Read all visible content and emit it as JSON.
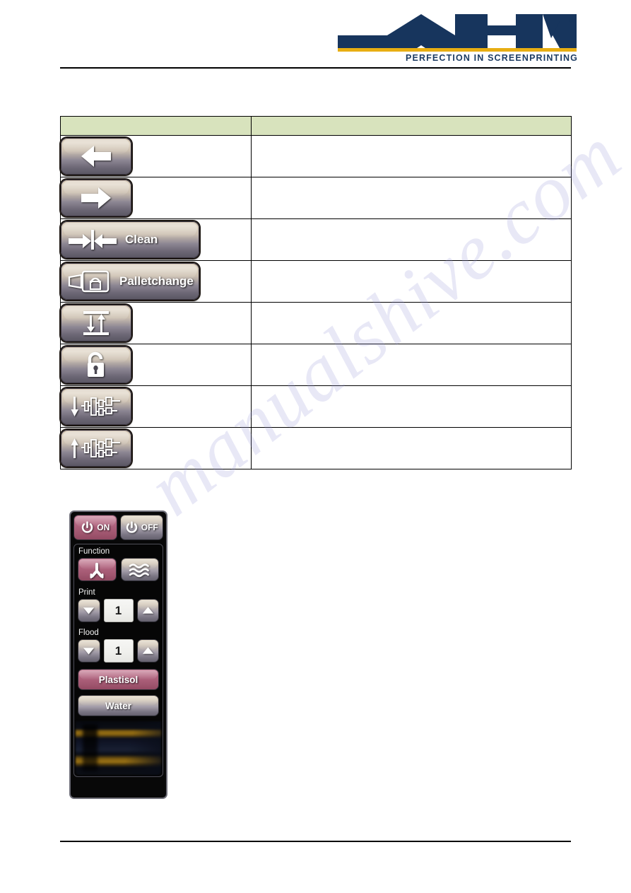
{
  "header": {
    "logo_text": "MHM",
    "logo_registered": "®",
    "tagline": "PERFECTION IN SCREENPRINTING"
  },
  "watermark": {
    "text": "manualshive.com"
  },
  "table": {
    "header_cells": [
      "",
      ""
    ],
    "rows": [
      {
        "icon_name": "arrow-left-button",
        "label": "",
        "description": ""
      },
      {
        "icon_name": "arrow-right-button",
        "label": "",
        "description": ""
      },
      {
        "icon_name": "clean-button",
        "label": "Clean",
        "description": ""
      },
      {
        "icon_name": "palletchange-button",
        "label": "Palletchange",
        "description": ""
      },
      {
        "icon_name": "platen-up-down-button",
        "label": "",
        "description": ""
      },
      {
        "icon_name": "padlock-open-button",
        "label": "",
        "description": ""
      },
      {
        "icon_name": "head-down-button",
        "label": "",
        "description": ""
      },
      {
        "icon_name": "head-up-button",
        "label": "",
        "description": ""
      }
    ]
  },
  "control_panel": {
    "power": {
      "on_label": "ON",
      "off_label": "OFF",
      "on_active": true,
      "on_color": "#b0637e",
      "off_color": "#7b7684"
    },
    "function": {
      "label": "Function",
      "options": [
        {
          "icon_name": "squeegee-icon",
          "selected": true
        },
        {
          "icon_name": "wavy-lines-icon",
          "selected": false
        }
      ]
    },
    "print": {
      "label": "Print",
      "value": "1",
      "decrement_icon": "triangle-down-icon",
      "increment_icon": "triangle-up-icon"
    },
    "flood": {
      "label": "Flood",
      "value": "1",
      "decrement_icon": "triangle-down-icon",
      "increment_icon": "triangle-up-icon"
    },
    "ink_modes": [
      {
        "label": "Plastisol",
        "selected": true
      },
      {
        "label": "Water",
        "selected": false
      }
    ]
  }
}
